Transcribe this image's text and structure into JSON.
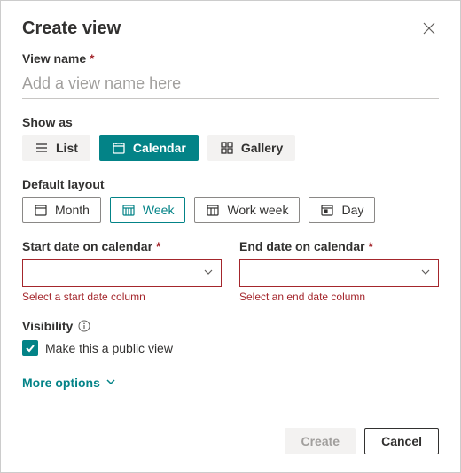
{
  "dialog": {
    "title": "Create view",
    "viewName": {
      "label": "View name",
      "value": "",
      "placeholder": "Add a view name here"
    },
    "showAs": {
      "label": "Show as",
      "options": [
        {
          "key": "list",
          "label": "List",
          "icon": "list-icon"
        },
        {
          "key": "calendar",
          "label": "Calendar",
          "icon": "calendar-icon"
        },
        {
          "key": "gallery",
          "label": "Gallery",
          "icon": "gallery-icon"
        }
      ],
      "selected": "calendar"
    },
    "defaultLayout": {
      "label": "Default layout",
      "options": [
        {
          "key": "month",
          "label": "Month",
          "icon": "calendar-month-icon"
        },
        {
          "key": "week",
          "label": "Week",
          "icon": "calendar-week-icon"
        },
        {
          "key": "workweek",
          "label": "Work week",
          "icon": "calendar-workweek-icon"
        },
        {
          "key": "day",
          "label": "Day",
          "icon": "calendar-day-icon"
        }
      ],
      "selected": "week"
    },
    "dates": {
      "startLabel": "Start date on calendar",
      "startValue": "",
      "startError": "Select a start date column",
      "endLabel": "End date on calendar",
      "endValue": "",
      "endError": "Select an end date column"
    },
    "visibility": {
      "label": "Visibility",
      "checkboxLabel": "Make this a public view",
      "checked": true
    },
    "moreOptions": "More options",
    "buttons": {
      "create": "Create",
      "cancel": "Cancel"
    }
  },
  "colors": {
    "accent": "#038387",
    "error": "#a4262c"
  }
}
